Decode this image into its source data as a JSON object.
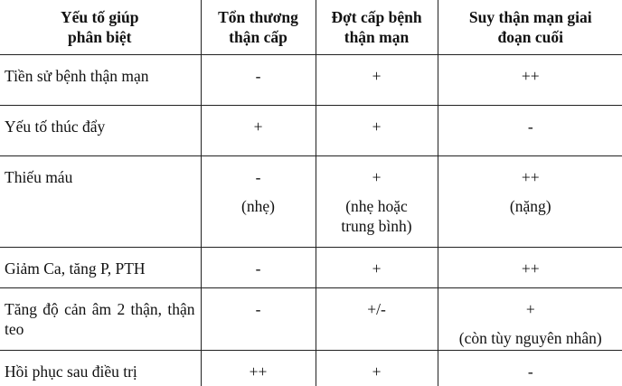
{
  "headers": [
    "Yếu tố giúp phân biệt",
    "Tổn thương thận cấp",
    "Đợt cấp bệnh thận mạn",
    "Suy thận mạn giai đoạn cuối"
  ],
  "rows": [
    {
      "factor": "Tiền sử bệnh thận mạn",
      "aki": {
        "v": "-"
      },
      "ackd": {
        "v": "+"
      },
      "esrd": {
        "v": "++"
      }
    },
    {
      "factor": "Yếu tố thúc đẩy",
      "aki": {
        "v": "+"
      },
      "ackd": {
        "v": "+"
      },
      "esrd": {
        "v": "-"
      }
    },
    {
      "factor": "Thiếu máu",
      "aki": {
        "v": "-",
        "note": "(nhẹ)"
      },
      "ackd": {
        "v": "+",
        "note": "(nhẹ hoặc trung bình)"
      },
      "esrd": {
        "v": "++",
        "note": "(nặng)"
      }
    },
    {
      "factor": "Giảm Ca, tăng P, PTH",
      "aki": {
        "v": "-"
      },
      "ackd": {
        "v": "+"
      },
      "esrd": {
        "v": "++"
      }
    },
    {
      "factor": "Tăng độ cản âm 2 thận, thận teo",
      "aki": {
        "v": "-"
      },
      "ackd": {
        "v": "+/-"
      },
      "esrd": {
        "v": "+",
        "note": "(còn tùy nguyên nhân)"
      }
    },
    {
      "factor": "Hồi phục sau điều trị",
      "aki": {
        "v": "++"
      },
      "ackd": {
        "v": "+"
      },
      "esrd": {
        "v": "-"
      }
    }
  ]
}
